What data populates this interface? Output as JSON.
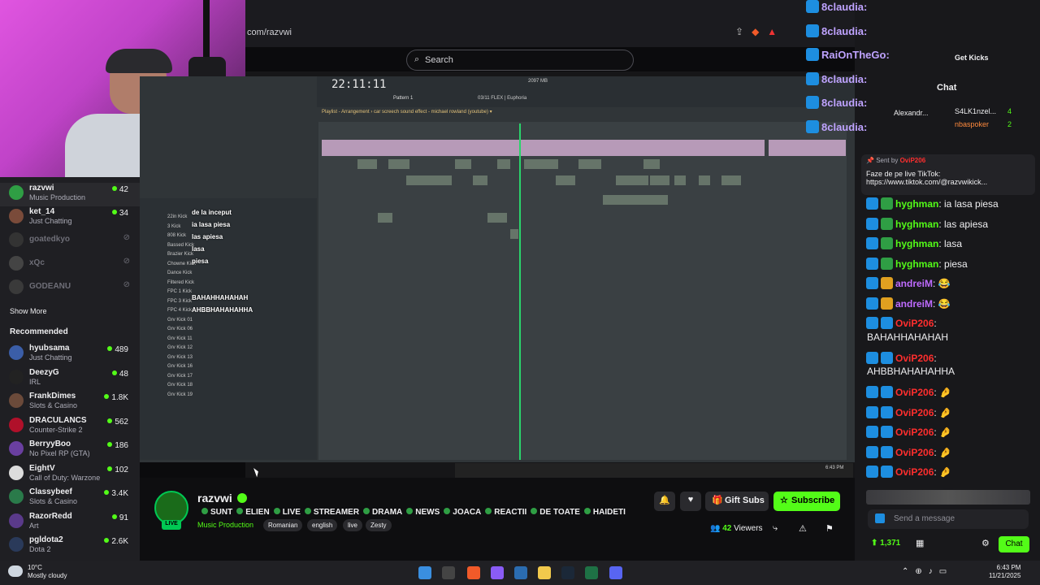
{
  "browser": {
    "url": "com/razvwi",
    "search_placeholder": "Search",
    "get_kicks": "Get Kicks"
  },
  "sidebar": {
    "channels": [
      {
        "name": "razvwi",
        "category": "Music Production",
        "viewers": "42",
        "live": true,
        "color": "#2f9e44"
      },
      {
        "name": "ket_14",
        "category": "Just Chatting",
        "viewers": "34",
        "live": true,
        "color": "#7a4b3a"
      },
      {
        "name": "goatedkyo",
        "category": "",
        "viewers": "",
        "live": false,
        "color": "#333"
      },
      {
        "name": "xQc",
        "category": "",
        "viewers": "",
        "live": false,
        "color": "#444"
      },
      {
        "name": "GODEANU",
        "category": "",
        "viewers": "",
        "live": false,
        "color": "#3a3a3a"
      }
    ],
    "show_more": "Show More",
    "recommended_title": "Recommended",
    "recommended": [
      {
        "name": "hyubsama",
        "category": "Just Chatting",
        "viewers": "489",
        "color": "#3b5ea8"
      },
      {
        "name": "DeezyG",
        "category": "IRL",
        "viewers": "48",
        "color": "#222"
      },
      {
        "name": "FrankDimes",
        "category": "Slots & Casino",
        "viewers": "1.8K",
        "color": "#6b4a3a"
      },
      {
        "name": "DRACULANCS",
        "category": "Counter-Strike 2",
        "viewers": "562",
        "color": "#b0102a"
      },
      {
        "name": "BerryyBoo",
        "category": "No Pixel RP (GTA)",
        "viewers": "186",
        "color": "#6a3fa0"
      },
      {
        "name": "EightV",
        "category": "Call of Duty: Warzone",
        "viewers": "102",
        "color": "#dcdcdc"
      },
      {
        "name": "Classybeef",
        "category": "Slots & Casino",
        "viewers": "3.4K",
        "color": "#2a7a4a"
      },
      {
        "name": "RazorRedd",
        "category": "Art",
        "viewers": "91",
        "color": "#5a3a8a"
      },
      {
        "name": "pgldota2",
        "category": "Dota 2",
        "viewers": "2.6K",
        "color": "#2a3a5a"
      }
    ]
  },
  "daw": {
    "time": "22:11:11",
    "pattern": "Pattern 1",
    "cpu": "2097 MB",
    "plugin": "03/11 FLEX | Euphoria",
    "playlist_title": "Playlist - Arrangement › car screech sound effect - michael rowland (youtube) ▾",
    "tracks": [
      "Track 5",
      "Track 6",
      "Track 7",
      "Track 8",
      "Track 9",
      "Track 10",
      "Track 11",
      "Track 12",
      "Track 13",
      "Track 14",
      "Track 15",
      "Track 16",
      "Track 17",
      "Track 18",
      "Track 19"
    ],
    "browser_items": [
      "22in Kick",
      "3 Kick",
      "808 Kick",
      "Bassed Kick",
      "Brazier Kick",
      "Chowne Kick",
      "Dance Kick",
      "Filtered Kick",
      "FPC 1 Kick",
      "FPC 3 Kick",
      "FPC 4 Kick",
      "Grv Kick 01",
      "Grv Kick 06",
      "Grv Kick 11",
      "Grv Kick 12",
      "Grv Kick 13",
      "Grv Kick 16",
      "Grv Kick 17",
      "Grv Kick 18",
      "Grv Kick 19"
    ],
    "overlay_chat": [
      "de la inceput",
      "ia lasa piesa",
      "las apiesa",
      "lasa",
      "piesa",
      "BAHAHHAHAHAH",
      "AHBBHAHAHAHHA"
    ],
    "clock": "6:43 PM",
    "date": "11/21/2025"
  },
  "stream_info": {
    "name": "razvwi",
    "live_label": "LIVE",
    "title_words": [
      "SUNT",
      "ELIEN",
      "LIVE",
      "STREAMER",
      "DRAMA",
      "NEWS",
      "JOACA",
      "REACTII",
      "DE TOATE",
      "HAIDETI"
    ],
    "category": "Music Production",
    "tags": [
      "Romanian",
      "english",
      "live",
      "Zesty"
    ],
    "gift_subs": "Gift Subs",
    "subscribe": "Subscribe",
    "viewers": "42",
    "viewers_label": "Viewers"
  },
  "chat": {
    "title": "Chat",
    "floating": [
      "8claudia:",
      "8claudia:",
      "RaiOnTheGo:",
      "8claudia:",
      "8claudia:",
      "8claudia:"
    ],
    "leaderboard": [
      {
        "name": "Alexandr...",
        "count": ""
      },
      {
        "name": "S4LK1nzel...",
        "count": "4"
      },
      {
        "name": "nbaspoker",
        "count": "2"
      }
    ],
    "pinned_sent_by": "Sent by",
    "pinned_user": "OviP206",
    "pinned_text": "Faze de pe live TikTok: https://www.tiktok.com/@razvwikick...",
    "messages": [
      {
        "user": "hyghman",
        "text": "ia lasa piesa",
        "color": "#53fc18"
      },
      {
        "user": "hyghman",
        "text": "las apiesa",
        "color": "#53fc18"
      },
      {
        "user": "hyghman",
        "text": "lasa",
        "color": "#53fc18"
      },
      {
        "user": "hyghman",
        "text": "piesa",
        "color": "#53fc18"
      },
      {
        "user": "andreiM",
        "text": "😂",
        "color": "#bf6bff"
      },
      {
        "user": "andreiM",
        "text": "😂",
        "color": "#bf6bff"
      },
      {
        "user": "OviP206",
        "text": "",
        "color": "#ff2e2e",
        "cont": "BAHAHHAHAHAH"
      },
      {
        "user": "OviP206",
        "text": "",
        "color": "#ff2e2e",
        "cont": "AHBBHAHAHAHHA"
      },
      {
        "user": "OviP206",
        "text": "🤌",
        "color": "#ff2e2e"
      },
      {
        "user": "OviP206",
        "text": "🤌",
        "color": "#ff2e2e"
      },
      {
        "user": "OviP206",
        "text": "🤌",
        "color": "#ff2e2e"
      },
      {
        "user": "OviP206",
        "text": "🤌",
        "color": "#ff2e2e"
      },
      {
        "user": "OviP206",
        "text": "🤌",
        "color": "#ff2e2e"
      }
    ],
    "input_placeholder": "Send a message",
    "points": "1,371",
    "send_button": "Chat"
  },
  "os": {
    "weather_temp": "10°C",
    "weather_desc": "Mostly cloudy",
    "time": "6:43 PM",
    "date": "11/21/2025"
  },
  "colors": {
    "kick_green": "#53fc18",
    "sidebar_bg": "#1f1f23",
    "chat_bg": "#18181b"
  }
}
